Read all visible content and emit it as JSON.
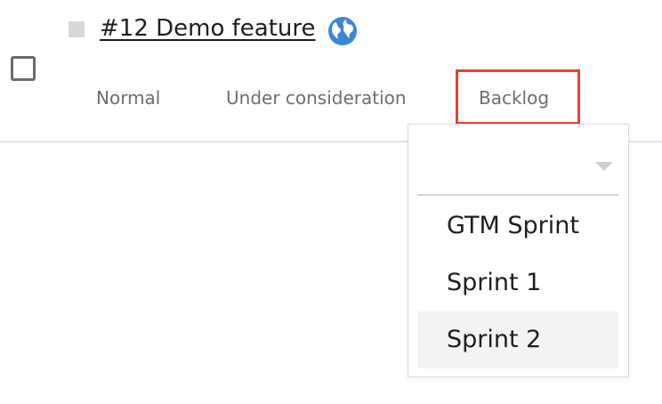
{
  "feature": {
    "title": "#12 Demo feature",
    "icon": "globe-icon"
  },
  "meta": {
    "status": "Normal",
    "workflow": "Under consideration",
    "release": "Backlog"
  },
  "release_dropdown": {
    "search_value": "",
    "options": [
      {
        "label": "GTM Sprint"
      },
      {
        "label": "Sprint 1"
      },
      {
        "label": "Sprint 2"
      }
    ],
    "hovered_option": "Sprint 2"
  },
  "colors": {
    "highlight": "#e5432f",
    "globe": "#3d86d6",
    "hover_bg": "#f3f3f3"
  }
}
